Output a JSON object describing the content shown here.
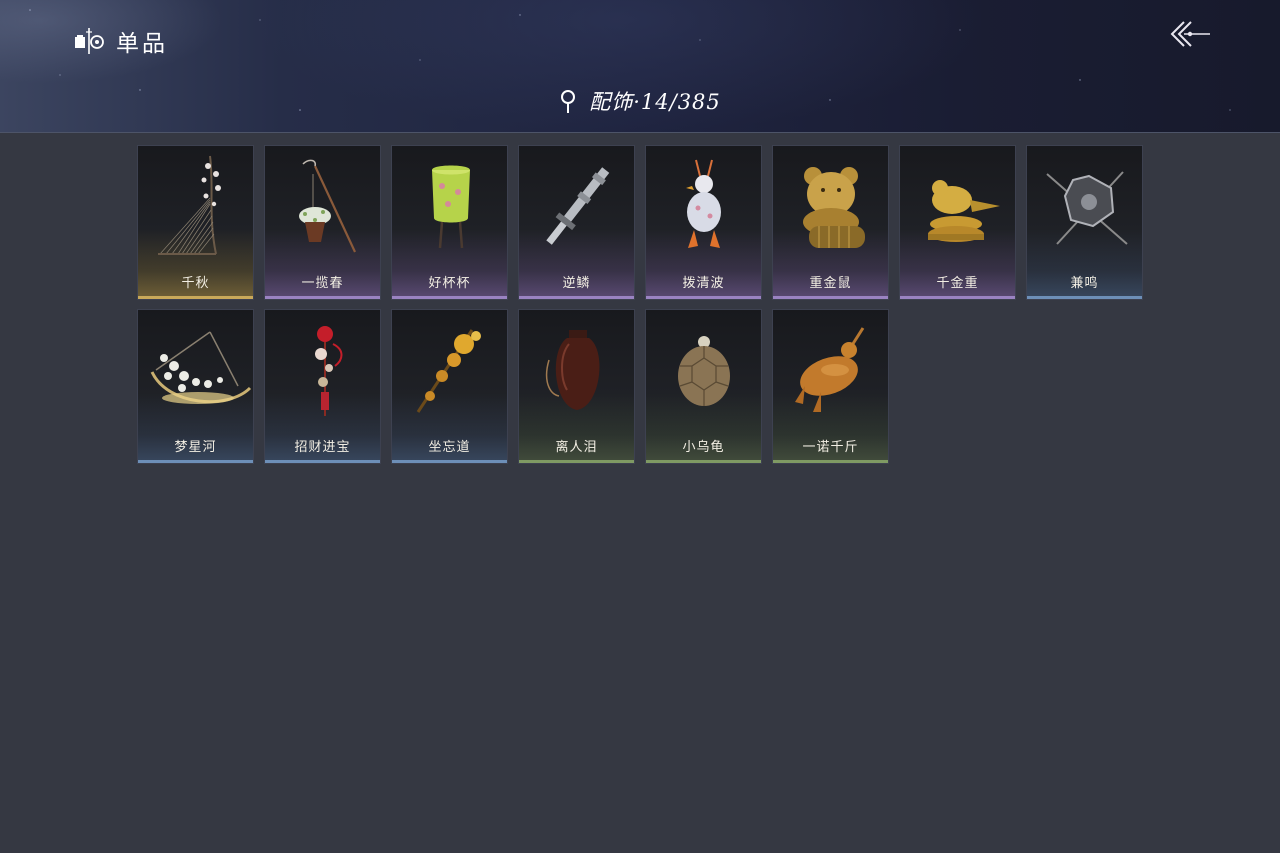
{
  "header": {
    "title": "单品",
    "title_icon": "collection-icon",
    "back_icon": "back-arrow-icon"
  },
  "category": {
    "icon": "location-pin-icon",
    "label": "配饰·14/385"
  },
  "rarity_colors": {
    "gold": "#c9a95a",
    "purple": "#9a83c2",
    "blue": "#6d8fb8",
    "green": "#7f9a63"
  },
  "items": [
    {
      "name": "千秋",
      "rarity": "gold",
      "icon": "harp-flower-branch-icon"
    },
    {
      "name": "一揽春",
      "rarity": "purple",
      "icon": "flower-basket-pole-icon"
    },
    {
      "name": "好杯杯",
      "rarity": "purple",
      "icon": "green-cup-creature-icon"
    },
    {
      "name": "逆鳞",
      "rarity": "purple",
      "icon": "silver-sword-hilt-icon"
    },
    {
      "name": "拨清波",
      "rarity": "purple",
      "icon": "white-duck-icon"
    },
    {
      "name": "重金鼠",
      "rarity": "purple",
      "icon": "golden-mouse-coins-icon"
    },
    {
      "name": "千金重",
      "rarity": "purple",
      "icon": "golden-bird-coins-icon"
    },
    {
      "name": "兼鸣",
      "rarity": "blue",
      "icon": "iron-shield-ornament-icon"
    },
    {
      "name": "梦星河",
      "rarity": "blue",
      "icon": "flower-swing-icon"
    },
    {
      "name": "招财进宝",
      "rarity": "blue",
      "icon": "red-tassel-charm-icon"
    },
    {
      "name": "坐忘道",
      "rarity": "blue",
      "icon": "golden-staff-icon"
    },
    {
      "name": "离人泪",
      "rarity": "green",
      "icon": "wine-jar-icon"
    },
    {
      "name": "小乌龟",
      "rarity": "green",
      "icon": "turtle-icon"
    },
    {
      "name": "一诺千斤",
      "rarity": "green",
      "icon": "roast-chicken-icon"
    }
  ]
}
